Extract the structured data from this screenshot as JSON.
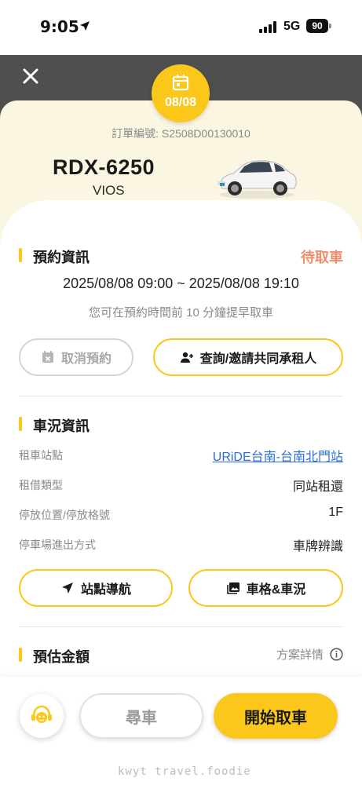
{
  "status_bar": {
    "time": "9:05",
    "network": "5G",
    "battery": "90"
  },
  "header": {
    "date_badge": "08/08",
    "order_number": "訂單編號: S2508D00130010",
    "plate": "RDX-6250",
    "model": "VIOS"
  },
  "reservation": {
    "title": "預約資訊",
    "status": "待取車",
    "time_range": "2025/08/08 09:00 ~ 2025/08/08 19:10",
    "note": "您可在預約時間前 10 分鐘提早取車",
    "cancel_label": "取消預約",
    "invite_label": "查詢/邀請共同承租人"
  },
  "vehicle": {
    "title": "車況資訊",
    "rows": [
      {
        "label": "租車站點",
        "value": "URiDE台南-台南北門站"
      },
      {
        "label": "租借類型",
        "value": "同站租還"
      },
      {
        "label": "停放位置/停放格號",
        "value": "1F"
      },
      {
        "label": "停車場進出方式",
        "value": "車牌辨識"
      }
    ],
    "navigate_label": "站點導航",
    "spot_label": "車格&車況"
  },
  "estimate": {
    "title": "預估金額",
    "plan_detail": "方案詳情"
  },
  "actions": {
    "find_label": "尋車",
    "start_label": "開始取車"
  },
  "watermark": "kwyt travel.foodie",
  "colors": {
    "accent": "#fbc71a",
    "pending": "#ef8e6a",
    "link": "#2a6fd6"
  },
  "icons": [
    "location-arrow-icon",
    "signal-icon",
    "close-icon",
    "calendar-icon",
    "car-image",
    "calendar-cancel-icon",
    "add-user-icon",
    "navigation-icon",
    "image-icon",
    "info-icon",
    "customer-service-icon"
  ]
}
